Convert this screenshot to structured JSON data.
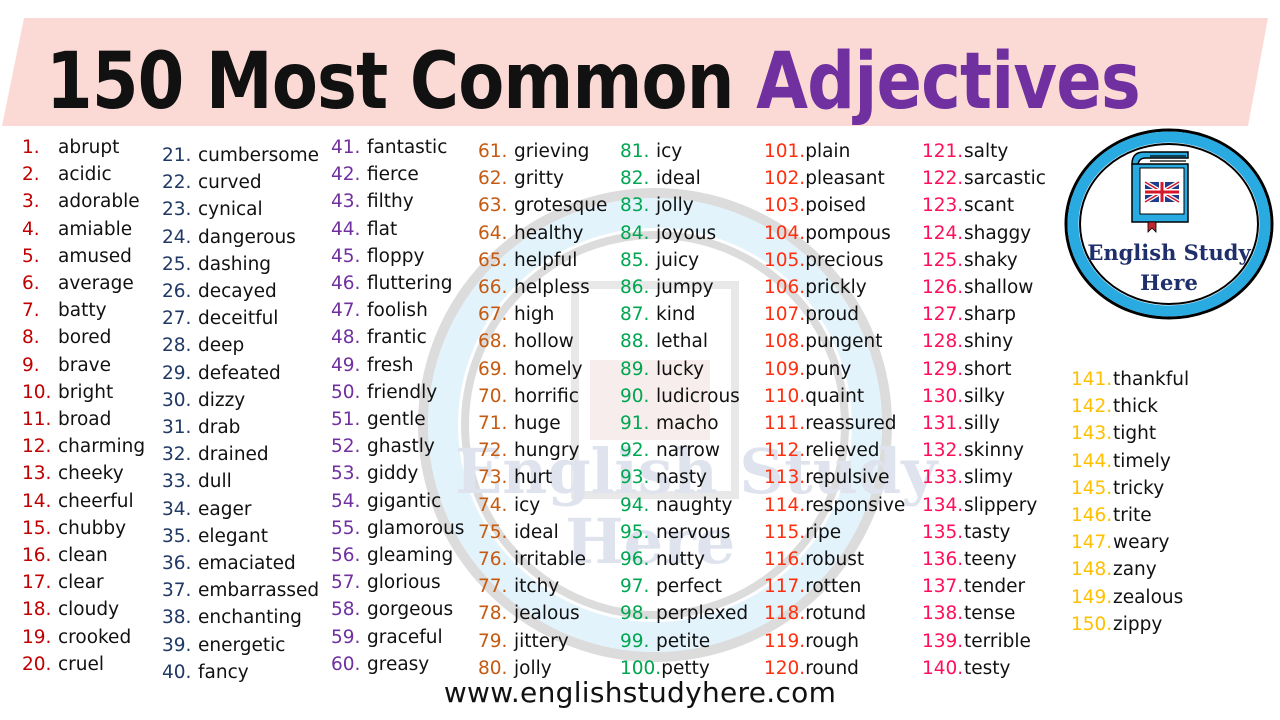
{
  "header": {
    "title_main": "150 Most Common",
    "title_accent": "Adjectives",
    "accent_color": "#7030a0",
    "banner_color": "#fbdad6"
  },
  "logo": {
    "line1": "English Study",
    "line2": "Here",
    "ring_color": "#29abe2",
    "icon": "book-with-uk-flag-icon"
  },
  "watermark": {
    "line1": "English Study",
    "line2": "Here"
  },
  "columns": [
    {
      "color": "#c00000",
      "items": [
        {
          "n": "1.",
          "w": "abrupt"
        },
        {
          "n": "2.",
          "w": "acidic"
        },
        {
          "n": "3.",
          "w": "adorable"
        },
        {
          "n": "4.",
          "w": "amiable"
        },
        {
          "n": "5.",
          "w": "amused"
        },
        {
          "n": "6.",
          "w": "average"
        },
        {
          "n": "7.",
          "w": "batty"
        },
        {
          "n": "8.",
          "w": "bored"
        },
        {
          "n": "9.",
          "w": "brave"
        },
        {
          "n": "10.",
          "w": "bright"
        },
        {
          "n": "11.",
          "w": "broad"
        },
        {
          "n": "12.",
          "w": "charming"
        },
        {
          "n": "13.",
          "w": "cheeky"
        },
        {
          "n": "14.",
          "w": "cheerful"
        },
        {
          "n": "15.",
          "w": "chubby"
        },
        {
          "n": "16.",
          "w": "clean"
        },
        {
          "n": "17.",
          "w": "clear"
        },
        {
          "n": "18.",
          "w": "cloudy"
        },
        {
          "n": "19.",
          "w": "crooked"
        },
        {
          "n": "20.",
          "w": "cruel"
        }
      ]
    },
    {
      "color": "#1f3864",
      "items": [
        {
          "n": "21.",
          "w": "cumbersome"
        },
        {
          "n": "22.",
          "w": "curved"
        },
        {
          "n": "23.",
          "w": "cynical"
        },
        {
          "n": "24.",
          "w": "dangerous"
        },
        {
          "n": "25.",
          "w": "dashing"
        },
        {
          "n": "26.",
          "w": "decayed"
        },
        {
          "n": "27.",
          "w": "deceitful"
        },
        {
          "n": "28.",
          "w": "deep"
        },
        {
          "n": "29.",
          "w": "defeated"
        },
        {
          "n": "30.",
          "w": "dizzy"
        },
        {
          "n": "31.",
          "w": "drab"
        },
        {
          "n": "32.",
          "w": "drained"
        },
        {
          "n": "33.",
          "w": "dull"
        },
        {
          "n": "34.",
          "w": "eager"
        },
        {
          "n": "35.",
          "w": "elegant"
        },
        {
          "n": "36.",
          "w": "emaciated"
        },
        {
          "n": "37.",
          "w": "embarrassed"
        },
        {
          "n": "38.",
          "w": "enchanting"
        },
        {
          "n": "39.",
          "w": "energetic"
        },
        {
          "n": "40.",
          "w": "fancy"
        }
      ]
    },
    {
      "color": "#7030a0",
      "items": [
        {
          "n": "41.",
          "w": "fantastic"
        },
        {
          "n": "42.",
          "w": "fierce"
        },
        {
          "n": "43.",
          "w": "filthy"
        },
        {
          "n": "44.",
          "w": "flat"
        },
        {
          "n": "45.",
          "w": "floppy"
        },
        {
          "n": "46.",
          "w": "fluttering"
        },
        {
          "n": "47.",
          "w": "foolish"
        },
        {
          "n": "48.",
          "w": "frantic"
        },
        {
          "n": "49.",
          "w": "fresh"
        },
        {
          "n": "50.",
          "w": "friendly"
        },
        {
          "n": "51.",
          "w": "gentle"
        },
        {
          "n": "52.",
          "w": "ghastly"
        },
        {
          "n": "53.",
          "w": "giddy"
        },
        {
          "n": "54.",
          "w": "gigantic"
        },
        {
          "n": "55.",
          "w": "glamorous"
        },
        {
          "n": "56.",
          "w": "gleaming"
        },
        {
          "n": "57.",
          "w": "glorious"
        },
        {
          "n": "58.",
          "w": "gorgeous"
        },
        {
          "n": "59.",
          "w": "graceful"
        },
        {
          "n": "60.",
          "w": "greasy"
        }
      ]
    },
    {
      "color": "#c55a11",
      "items": [
        {
          "n": "61.",
          "w": "grieving"
        },
        {
          "n": "62.",
          "w": "gritty"
        },
        {
          "n": "63.",
          "w": "grotesque"
        },
        {
          "n": "64.",
          "w": "healthy"
        },
        {
          "n": "65.",
          "w": "helpful"
        },
        {
          "n": "66.",
          "w": "helpless"
        },
        {
          "n": "67.",
          "w": "high"
        },
        {
          "n": "68.",
          "w": "hollow"
        },
        {
          "n": "69.",
          "w": "homely"
        },
        {
          "n": "70.",
          "w": "horrific"
        },
        {
          "n": "71.",
          "w": "huge"
        },
        {
          "n": "72.",
          "w": "hungry"
        },
        {
          "n": "73.",
          "w": "hurt"
        },
        {
          "n": "74.",
          "w": "icy"
        },
        {
          "n": "75.",
          "w": "ideal"
        },
        {
          "n": "76.",
          "w": "irritable"
        },
        {
          "n": "77.",
          "w": "itchy"
        },
        {
          "n": "78.",
          "w": "jealous"
        },
        {
          "n": "79.",
          "w": "jittery"
        },
        {
          "n": "80.",
          "w": "jolly"
        }
      ]
    },
    {
      "color": "#00a651",
      "items": [
        {
          "n": "81.",
          "w": "icy"
        },
        {
          "n": "82.",
          "w": "ideal"
        },
        {
          "n": "83.",
          "w": "jolly"
        },
        {
          "n": "84.",
          "w": "joyous"
        },
        {
          "n": "85.",
          "w": "juicy"
        },
        {
          "n": "86.",
          "w": "jumpy"
        },
        {
          "n": "87.",
          "w": "kind"
        },
        {
          "n": "88.",
          "w": "lethal"
        },
        {
          "n": "89.",
          "w": "lucky"
        },
        {
          "n": "90.",
          "w": "ludicrous"
        },
        {
          "n": "91.",
          "w": "macho"
        },
        {
          "n": "92.",
          "w": "narrow"
        },
        {
          "n": "93.",
          "w": "nasty"
        },
        {
          "n": "94.",
          "w": "naughty"
        },
        {
          "n": "95.",
          "w": "nervous"
        },
        {
          "n": "96.",
          "w": "nutty"
        },
        {
          "n": "97.",
          "w": "perfect"
        },
        {
          "n": "98.",
          "w": "perplexed"
        },
        {
          "n": "99.",
          "w": "petite"
        },
        {
          "n": "100.",
          "w": "petty"
        }
      ]
    },
    {
      "color": "#ff2f0f",
      "items": [
        {
          "n": "101.",
          "w": "plain"
        },
        {
          "n": "102.",
          "w": "pleasant"
        },
        {
          "n": "103.",
          "w": "poised"
        },
        {
          "n": "104.",
          "w": "pompous"
        },
        {
          "n": "105.",
          "w": "precious"
        },
        {
          "n": "106.",
          "w": "prickly"
        },
        {
          "n": "107.",
          "w": "proud"
        },
        {
          "n": "108.",
          "w": "pungent"
        },
        {
          "n": "109.",
          "w": "puny"
        },
        {
          "n": "110.",
          "w": "quaint"
        },
        {
          "n": "111.",
          "w": "reassured"
        },
        {
          "n": "112.",
          "w": "relieved"
        },
        {
          "n": "113.",
          "w": "repulsive"
        },
        {
          "n": "114.",
          "w": "responsive"
        },
        {
          "n": "115.",
          "w": "ripe"
        },
        {
          "n": "116.",
          "w": "robust"
        },
        {
          "n": "117.",
          "w": "rotten"
        },
        {
          "n": "118.",
          "w": "rotund"
        },
        {
          "n": "119.",
          "w": "rough"
        },
        {
          "n": "120.",
          "w": "round"
        }
      ]
    },
    {
      "color": "#ff0f5a",
      "items": [
        {
          "n": "121.",
          "w": "salty"
        },
        {
          "n": "122.",
          "w": "sarcastic"
        },
        {
          "n": "123.",
          "w": "scant"
        },
        {
          "n": "124.",
          "w": "shaggy"
        },
        {
          "n": "125.",
          "w": "shaky"
        },
        {
          "n": "126.",
          "w": "shallow"
        },
        {
          "n": "127.",
          "w": "sharp"
        },
        {
          "n": "128.",
          "w": "shiny"
        },
        {
          "n": "129.",
          "w": "short"
        },
        {
          "n": "130.",
          "w": "silky"
        },
        {
          "n": "131.",
          "w": "silly"
        },
        {
          "n": "132.",
          "w": "skinny"
        },
        {
          "n": "133.",
          "w": "slimy"
        },
        {
          "n": "134.",
          "w": "slippery"
        },
        {
          "n": "135.",
          "w": "tasty"
        },
        {
          "n": "136.",
          "w": "teeny"
        },
        {
          "n": "137.",
          "w": "tender"
        },
        {
          "n": "138.",
          "w": "tense"
        },
        {
          "n": "139.",
          "w": "terrible"
        },
        {
          "n": "140.",
          "w": "testy"
        }
      ]
    },
    {
      "color": "#ffc000",
      "items": [
        {
          "n": "141.",
          "w": "thankful"
        },
        {
          "n": "142.",
          "w": "thick"
        },
        {
          "n": "143.",
          "w": "tight"
        },
        {
          "n": "144.",
          "w": "timely"
        },
        {
          "n": "145.",
          "w": "tricky"
        },
        {
          "n": "146.",
          "w": "trite"
        },
        {
          "n": "147.",
          "w": "weary"
        },
        {
          "n": "148.",
          "w": "zany"
        },
        {
          "n": "149.",
          "w": "zealous"
        },
        {
          "n": "150.",
          "w": "zippy"
        }
      ]
    }
  ],
  "footer": {
    "url": "www.englishstudyhere.com"
  }
}
